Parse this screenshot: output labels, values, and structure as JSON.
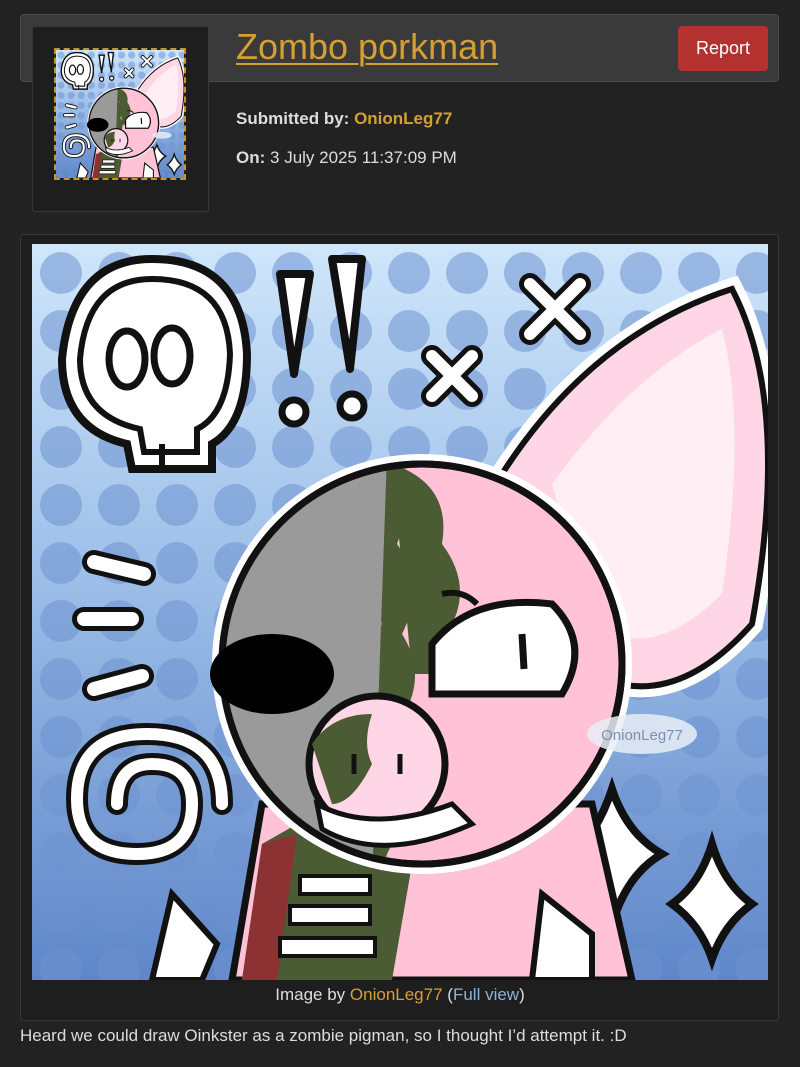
{
  "submission": {
    "title": "Zombo porkman",
    "report_label": "Report",
    "submitted_by_label": "Submitted by:",
    "submitted_by_user": "OnionLeg77",
    "on_label": "On:",
    "date": "3 July 2025 11:37:09 PM"
  },
  "image": {
    "caption_prefix": "Image by",
    "caption_artist": "OnionLeg77",
    "caption_open": "(",
    "full_view_label": "Full view",
    "caption_close": ")",
    "watermark": "OnionLeg77"
  },
  "description": "Heard we could draw Oinkster as a zombie pigman, so I thought I’d attempt it. :D",
  "colors": {
    "background": "#222222",
    "accent": "#d4a033",
    "report": "#b3312f",
    "link": "#8ab4d8"
  }
}
